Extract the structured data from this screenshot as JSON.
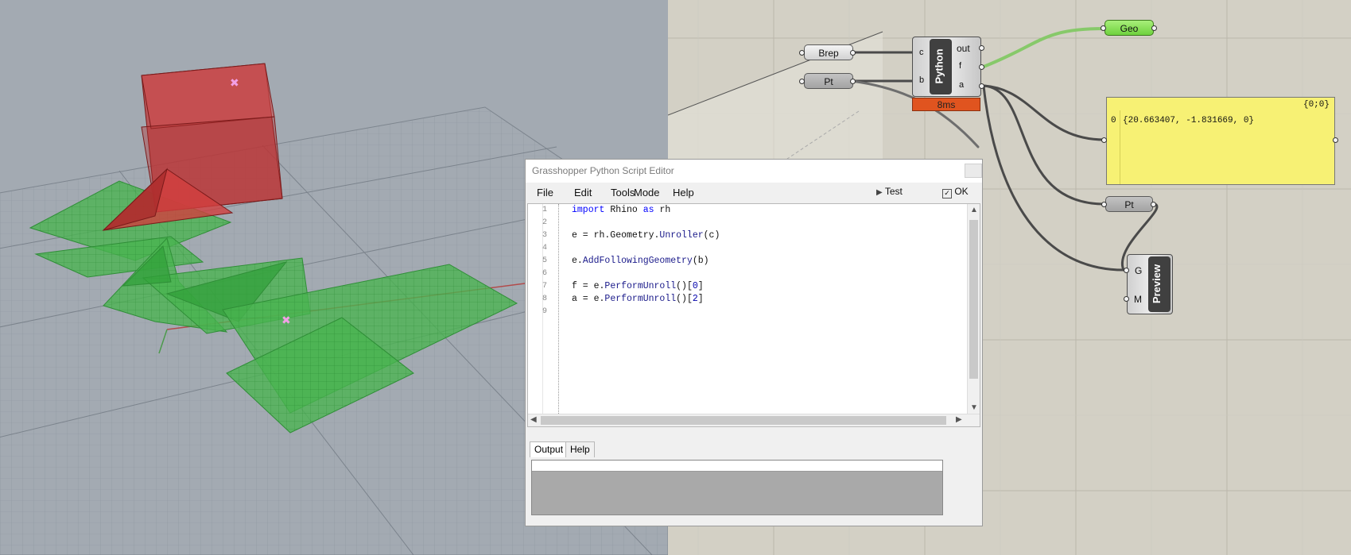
{
  "editor": {
    "title": "Grasshopper Python Script Editor",
    "menu": [
      "File",
      "Edit",
      "Tools",
      "Mode",
      "Help"
    ],
    "test_label": "Test",
    "ok_label": "OK",
    "line_numbers": [
      "1",
      "2",
      "3",
      "4",
      "5",
      "6",
      "7",
      "8",
      "9"
    ],
    "tabs": {
      "output": "Output",
      "help": "Help"
    }
  },
  "code_lines": [
    "import Rhino as rh",
    "",
    "e = rh.Geometry.Unroller(c)",
    "",
    "e.AddFollowingGeometry(b)",
    "",
    "f = e.PerformUnroll()[0]",
    "a = e.PerformUnroll()[2]",
    ""
  ],
  "canvas": {
    "brep_label": "Brep",
    "pt_label": "Pt",
    "geo_label": "Geo",
    "pt_out_label": "Pt",
    "python": {
      "name": "Python",
      "inputs": [
        "c",
        "b"
      ],
      "outputs": [
        "out",
        "f",
        "a"
      ],
      "timing": "8ms"
    },
    "panel": {
      "path": "{0;0}",
      "index": "0",
      "value": "{20.663407, -1.831669, 0}"
    },
    "preview": {
      "name": "Preview",
      "inputs": [
        "G",
        "M"
      ]
    }
  },
  "colors": {
    "viewport_bg": "#a3aab2",
    "canvas_bg": "#d3d0c5",
    "box_red": "#c0393b",
    "unroll_green": "#3fb24a",
    "panel_yellow": "#f7f174",
    "timing_orange": "#e0541f"
  }
}
